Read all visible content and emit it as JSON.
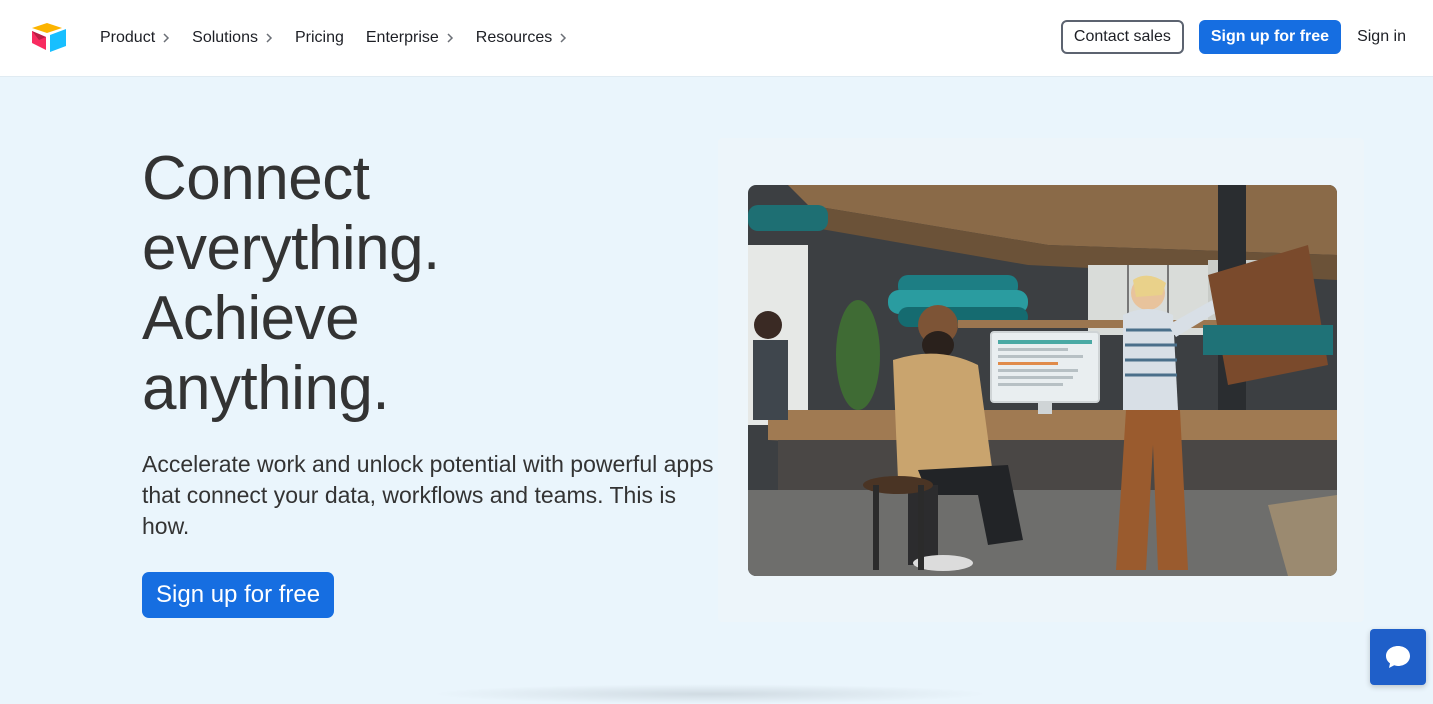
{
  "header": {
    "nav": [
      {
        "label": "Product",
        "has_chevron": true
      },
      {
        "label": "Solutions",
        "has_chevron": true
      },
      {
        "label": "Pricing",
        "has_chevron": false
      },
      {
        "label": "Enterprise",
        "has_chevron": true
      },
      {
        "label": "Resources",
        "has_chevron": true
      }
    ],
    "contact_sales": "Contact sales",
    "signup": "Sign up for free",
    "signin": "Sign in"
  },
  "hero": {
    "title_lines": [
      "Connect",
      "everything.",
      "Achieve",
      "anything."
    ],
    "subtitle": "Accelerate work and unlock potential with powerful apps that connect your data, workflows and teams. This is how.",
    "cta": "Sign up for free"
  },
  "icons": {
    "logo": "airtable-logo-icon",
    "chat": "chat-bubble-icon",
    "chevron": "chevron-right-icon"
  },
  "colors": {
    "primary": "#166ee1",
    "hero_bg": "#eaf5fc",
    "text": "#333333"
  }
}
